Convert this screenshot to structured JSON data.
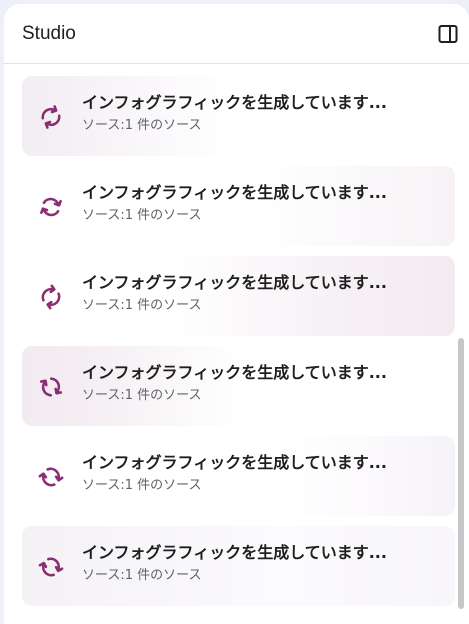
{
  "panel": {
    "title": "Studio",
    "toggle_icon": "side-panel-icon"
  },
  "accent_color": "#8b2d72",
  "items": [
    {
      "title": "インフォグラフィックを生成しています...",
      "subtitle": "ソース:1 件のソース",
      "icon": "sync-icon"
    },
    {
      "title": "インフォグラフィックを生成しています...",
      "subtitle": "ソース:1 件のソース",
      "icon": "sync-icon"
    },
    {
      "title": "インフォグラフィックを生成しています...",
      "subtitle": "ソース:1 件のソース",
      "icon": "sync-icon"
    },
    {
      "title": "インフォグラフィックを生成しています...",
      "subtitle": "ソース:1 件のソース",
      "icon": "sync-icon"
    },
    {
      "title": "インフォグラフィックを生成しています...",
      "subtitle": "ソース:1 件のソース",
      "icon": "sync-icon"
    },
    {
      "title": "インフォグラフィックを生成しています...",
      "subtitle": "ソース:1 件のソース",
      "icon": "sync-icon"
    }
  ]
}
